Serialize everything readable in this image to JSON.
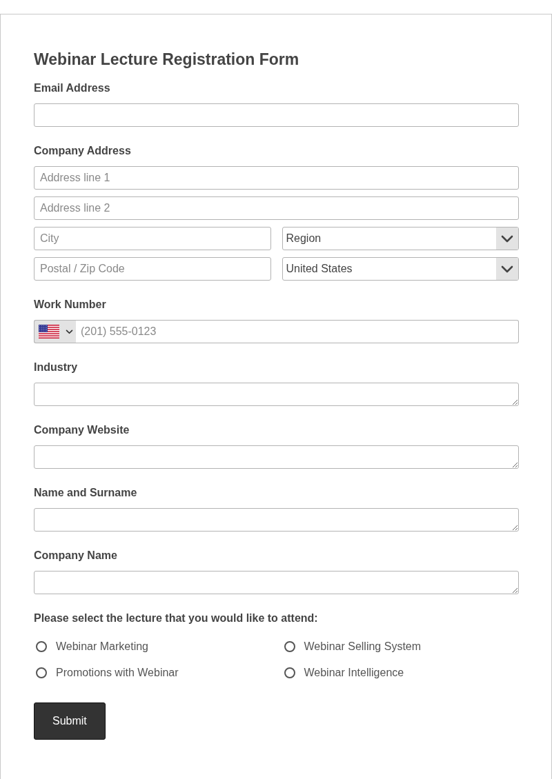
{
  "title": "Webinar Lecture Registration Form",
  "fields": [
    {
      "kind": "input",
      "label": "Email Address"
    },
    {
      "kind": "address",
      "label": "Company Address",
      "line1": {
        "placeholder": "Address line 1"
      },
      "line2": {
        "placeholder": "Address line 2"
      },
      "city": {
        "placeholder": "City"
      },
      "region": {
        "value": "Region"
      },
      "postal": {
        "placeholder": "Postal / Zip Code"
      },
      "country": {
        "value": "United States"
      }
    },
    {
      "kind": "phone",
      "label": "Work Number",
      "placeholder": "(201) 555-0123"
    },
    {
      "kind": "textarea",
      "label": "Industry"
    },
    {
      "kind": "textarea",
      "label": "Company Website"
    },
    {
      "kind": "textarea",
      "label": "Name and Surname"
    },
    {
      "kind": "textarea",
      "label": "Company Name"
    },
    {
      "kind": "radios",
      "label": "Please select the lecture that you would like to attend:",
      "options": [
        {
          "label": "Webinar Marketing",
          "selected": false
        },
        {
          "label": "Webinar Selling System",
          "selected": false
        },
        {
          "label": "Promotions with Webinar",
          "selected": false
        },
        {
          "label": "Webinar Intelligence",
          "selected": false
        }
      ]
    }
  ],
  "submit": {
    "label": "Submit"
  }
}
